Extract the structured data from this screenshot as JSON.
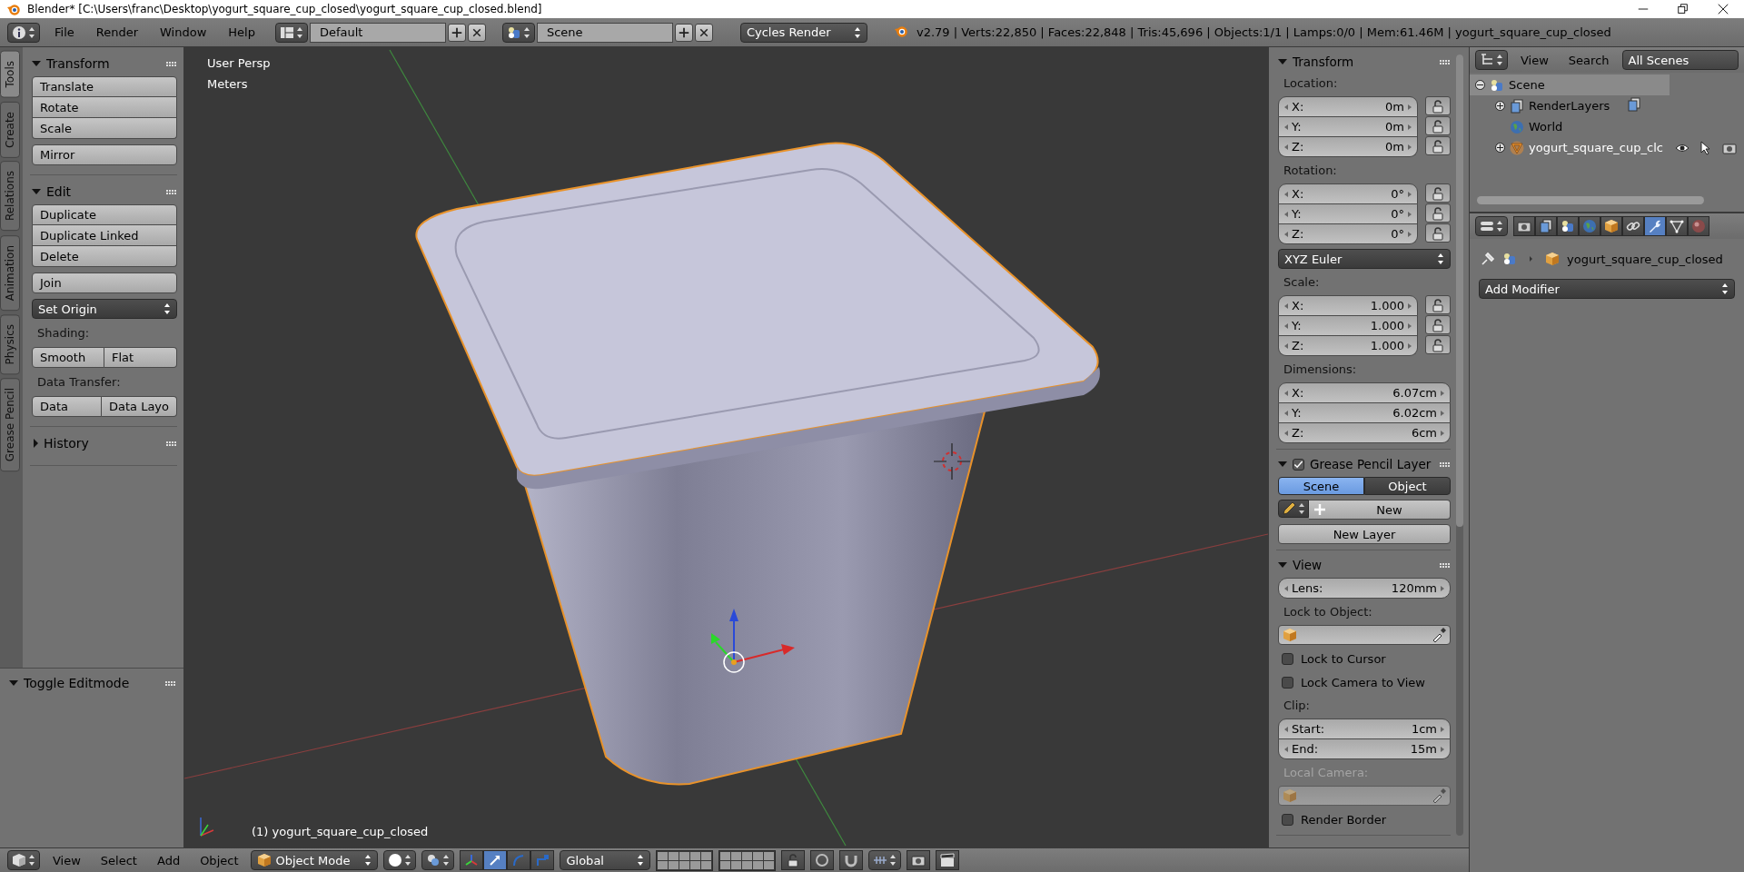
{
  "title_bar": {
    "title": "Blender* [C:\\Users\\franc\\Desktop\\yogurt_square_cup_closed\\yogurt_square_cup_closed.blend]"
  },
  "info_header": {
    "menus": [
      "File",
      "Render",
      "Window",
      "Help"
    ],
    "layout": "Default",
    "scene": "Scene",
    "engine": "Cycles Render",
    "stats": "v2.79 | Verts:22,850 | Faces:22,848 | Tris:45,696 | Objects:1/1 | Lamps:0/0 | Mem:61.46M | yogurt_square_cup_closed"
  },
  "tool_tabs": [
    {
      "label": "Tools",
      "selected": true
    },
    {
      "label": "Create",
      "selected": false
    },
    {
      "label": "Relations",
      "selected": false
    },
    {
      "label": "Animation",
      "selected": false
    },
    {
      "label": "Physics",
      "selected": false
    },
    {
      "label": "Grease Pencil",
      "selected": false
    }
  ],
  "tool_shelf": [
    {
      "title": "Transform",
      "expanded": true,
      "rows": [
        {
          "kind": "stack",
          "buttons": [
            "Translate",
            "Rotate",
            "Scale"
          ]
        },
        {
          "kind": "stack",
          "buttons": [
            "Mirror"
          ]
        }
      ]
    },
    {
      "title": "Edit",
      "expanded": true,
      "rows": [
        {
          "kind": "stack",
          "buttons": [
            "Duplicate",
            "Duplicate Linked",
            "Delete"
          ]
        },
        {
          "kind": "stack",
          "buttons": [
            "Join"
          ]
        },
        {
          "kind": "dropdown",
          "label": "Set Origin"
        },
        {
          "kind": "label",
          "label": "Shading:"
        },
        {
          "kind": "pair",
          "buttons": [
            "Smooth",
            "Flat"
          ]
        },
        {
          "kind": "label",
          "label": "Data Transfer:"
        },
        {
          "kind": "pair",
          "buttons": [
            "Data",
            "Data Layo"
          ]
        }
      ]
    },
    {
      "title": "History",
      "expanded": false
    }
  ],
  "operator_panel": {
    "title": "Toggle Editmode",
    "expanded": true
  },
  "viewport": {
    "view_name": "User Persp",
    "units": "Meters",
    "object_label": "(1) yogurt_square_cup_closed"
  },
  "properties_panel": [
    {
      "title": "Transform",
      "expanded": true,
      "rows": [
        {
          "kind": "label",
          "label": "Location:"
        },
        {
          "kind": "vector",
          "locks": true,
          "fields": [
            {
              "axis": "X:",
              "value": "0m"
            },
            {
              "axis": "Y:",
              "value": "0m"
            },
            {
              "axis": "Z:",
              "value": "0m"
            }
          ]
        },
        {
          "kind": "label",
          "label": "Rotation:"
        },
        {
          "kind": "vector",
          "locks": true,
          "fields": [
            {
              "axis": "X:",
              "value": "0°"
            },
            {
              "axis": "Y:",
              "value": "0°"
            },
            {
              "axis": "Z:",
              "value": "0°"
            }
          ]
        },
        {
          "kind": "dropdown",
          "label": "XYZ Euler"
        },
        {
          "kind": "label",
          "label": "Scale:"
        },
        {
          "kind": "vector",
          "locks": true,
          "fields": [
            {
              "axis": "X:",
              "value": "1.000"
            },
            {
              "axis": "Y:",
              "value": "1.000"
            },
            {
              "axis": "Z:",
              "value": "1.000"
            }
          ]
        },
        {
          "kind": "label",
          "label": "Dimensions:"
        },
        {
          "kind": "vector",
          "locks": false,
          "fields": [
            {
              "axis": "X:",
              "value": "6.07cm"
            },
            {
              "axis": "Y:",
              "value": "6.02cm"
            },
            {
              "axis": "Z:",
              "value": "6cm"
            }
          ]
        }
      ]
    },
    {
      "title": "Grease Pencil Layer",
      "expanded": true,
      "checked": true,
      "rows": [
        {
          "kind": "toggle",
          "options": [
            {
              "label": "Scene",
              "selected": true
            },
            {
              "label": "Object",
              "selected": false
            }
          ]
        },
        {
          "kind": "new",
          "label": "New"
        },
        {
          "kind": "button",
          "label": "New Layer"
        }
      ]
    },
    {
      "title": "View",
      "expanded": true,
      "rows": [
        {
          "kind": "vector",
          "locks": false,
          "fields": [
            {
              "axis": "Lens:",
              "value": "120mm"
            }
          ]
        },
        {
          "kind": "label",
          "label": "Lock to Object:"
        },
        {
          "kind": "object_field",
          "disabled": false
        },
        {
          "kind": "checkbox",
          "label": "Lock to Cursor",
          "checked": false
        },
        {
          "kind": "checkbox",
          "label": "Lock Camera to View",
          "checked": false
        },
        {
          "kind": "label",
          "label": "Clip:"
        },
        {
          "kind": "vector",
          "locks": false,
          "fields": [
            {
              "axis": "Start:",
              "value": "1cm"
            },
            {
              "axis": "End:",
              "value": "15m"
            }
          ]
        },
        {
          "kind": "label",
          "label": "Local Camera:",
          "disabled": true
        },
        {
          "kind": "object_field",
          "disabled": true
        },
        {
          "kind": "checkbox",
          "label": "Render Border",
          "checked": false
        }
      ]
    }
  ],
  "outliner": {
    "menus": [
      "View",
      "Search"
    ],
    "display_mode": "All Scenes",
    "tree": [
      {
        "kind": "scene",
        "label": "Scene",
        "expanded": true,
        "selected": true,
        "children": [
          {
            "kind": "render_layers",
            "label": "RenderLayers",
            "expanded": false,
            "selected": false
          },
          {
            "kind": "world",
            "label": "World",
            "selected": false
          },
          {
            "kind": "mesh",
            "label": "yogurt_square_cup_clc",
            "expanded": false,
            "selected": false
          }
        ]
      }
    ]
  },
  "properties_editor": {
    "tabs": [
      {
        "kind": "render",
        "selected": false
      },
      {
        "kind": "render_layers",
        "selected": false
      },
      {
        "kind": "scene",
        "selected": false
      },
      {
        "kind": "world",
        "selected": false
      },
      {
        "kind": "object",
        "selected": false
      },
      {
        "kind": "constraints",
        "selected": false
      },
      {
        "kind": "modifiers",
        "selected": true
      },
      {
        "kind": "data",
        "selected": false
      },
      {
        "kind": "material",
        "selected": false
      }
    ],
    "object_name": "yogurt_square_cup_closed",
    "add_modifier": "Add Modifier"
  },
  "view3d_header": {
    "menus": [
      "View",
      "Select",
      "Add",
      "Object"
    ],
    "mode": "Object Mode",
    "transform_tools": [
      {
        "kind": "translate",
        "selected": true
      },
      {
        "kind": "rotate",
        "selected": false
      },
      {
        "kind": "scale",
        "selected": false
      }
    ],
    "orientation": "Global"
  }
}
